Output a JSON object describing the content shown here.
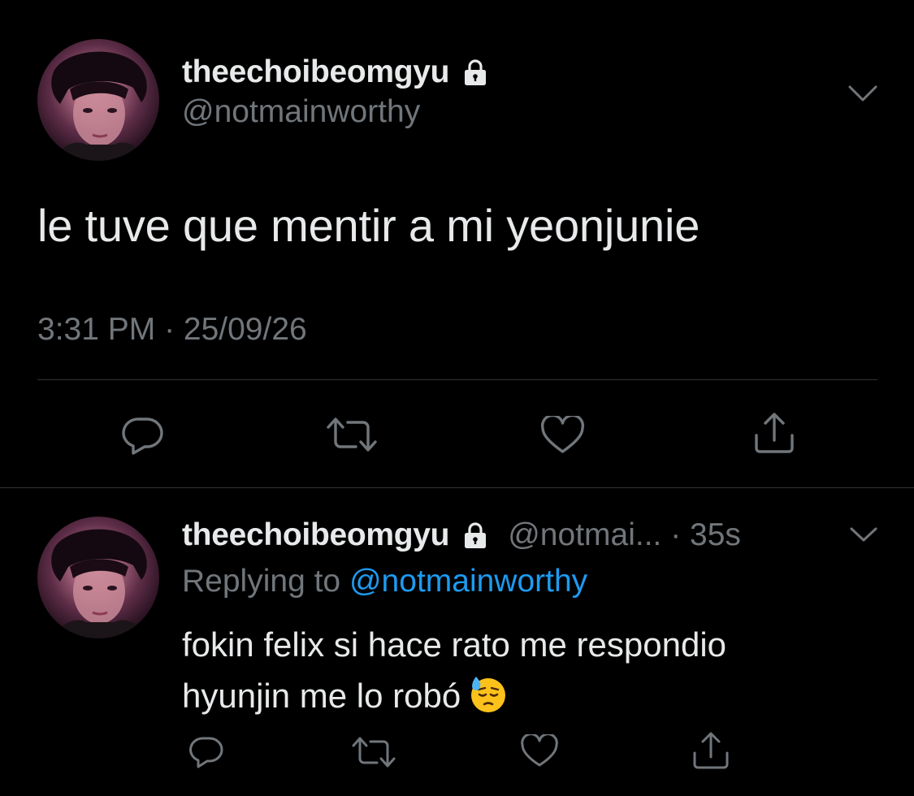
{
  "main_tweet": {
    "display_name": "theechoibeomgyu",
    "handle": "@notmainworthy",
    "text": "le tuve que mentir a mi yeonjunie",
    "timestamp": "3:31 PM · 25/09/26",
    "icons": {
      "lock": "lock-icon",
      "menu": "chevron-down-icon",
      "reply": "reply-icon",
      "retweet": "retweet-icon",
      "like": "heart-icon",
      "share": "share-icon"
    }
  },
  "reply_tweet": {
    "display_name": "theechoibeomgyu",
    "handle_time": "@notmai... · 35s",
    "replying_prefix": "Replying to",
    "replying_to": "@notmainworthy",
    "text_line1": "fokin felix si hace rato me respondio",
    "text_line2": "hyunjin me lo robó",
    "emoji": "downcast-face-with-sweat-emoji"
  },
  "colors": {
    "background": "#000000",
    "text_primary": "#e7e9ea",
    "text_secondary": "#71767b",
    "accent": "#1d9bf0",
    "divider": "#2f3336"
  }
}
